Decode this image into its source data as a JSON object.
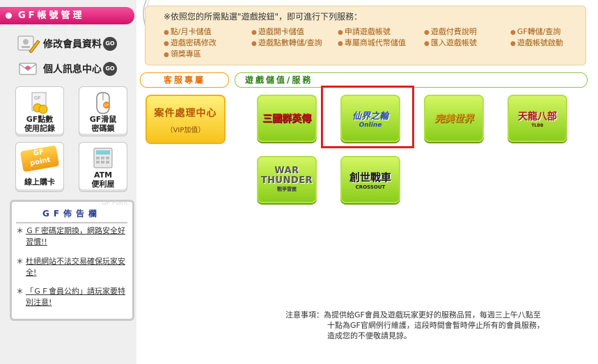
{
  "sidebar": {
    "header": "GF帳號管理",
    "links": [
      {
        "label": "修改會員資料",
        "go": "GO"
      },
      {
        "label": "個人訊息中心",
        "go": "GO"
      }
    ],
    "tiles": [
      {
        "line1": "GF點數",
        "line2": "使用記錄"
      },
      {
        "line1": "GF滑鼠",
        "line2": "密碼鎖"
      },
      {
        "line1": "線上購卡",
        "line2": "",
        "badge_top": "GF",
        "badge_bottom": "point"
      },
      {
        "line1": "ATM",
        "line2": "便利屋"
      }
    ],
    "notice": {
      "watermark": "GF Point",
      "title": "GF佈告欄",
      "items": [
        "ＧＦ密碼定期換，網路安全好習慣!!",
        "杜絕網站不法交易確保玩家安全!",
        "「ＧＦ會員公約」請玩家要特別注意!"
      ]
    }
  },
  "info": {
    "heading": "※依照您的所需點選\"遊戲按鈕\"，即可進行下列服務：",
    "services": [
      "點/月卡儲值",
      "遊戲開卡儲值",
      "申請遊戲帳號",
      "遊戲付費說明",
      "GF轉儲/查詢",
      "遊戲密碼修改",
      "遊戲點數轉儲/查詢",
      "專屬商城代幣儲值",
      "匯入遊戲帳號",
      "遊戲帳號啟動",
      "領獎專區"
    ]
  },
  "tabs": {
    "service": "客服專屬",
    "game": "遊戲儲值/服務"
  },
  "case_center": {
    "title": "案件處理中心",
    "subtitle": "（VIP加值）"
  },
  "games": [
    {
      "name": "三國群英傳",
      "color": "#c2191a"
    },
    {
      "name": "仙界之輪",
      "sub": "Online",
      "color": "#2a4fa8",
      "selected": true
    },
    {
      "name": "完美世界",
      "color": "#d6a21a"
    },
    {
      "name": "天龍八部",
      "sub": "TLBB",
      "color": "#b21414"
    },
    {
      "name": "WAR THUNDER",
      "sub": "戰爭雷霆",
      "color": "#6b6b6b"
    },
    {
      "name": "創世戰車",
      "sub": "CROSSOUT",
      "color": "#111111"
    }
  ],
  "footer": {
    "label": "注意事項：",
    "lines": [
      "為提供給GF會員及遊戲玩家更好的服務品質，每週三上午八點至",
      "十點為GF官網例行維護，這段時間會暫時停止所有的會員服務，",
      "造成您的不便敬請見諒。"
    ]
  }
}
